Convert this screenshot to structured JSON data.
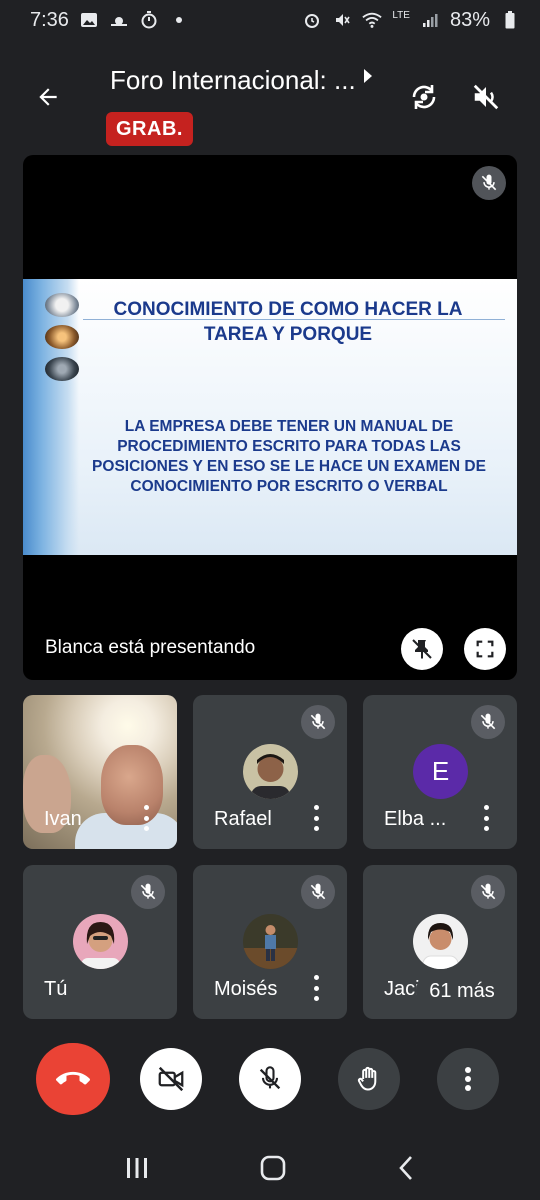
{
  "status_bar": {
    "time": "7:36",
    "network_label": "LTE",
    "battery": "83%"
  },
  "header": {
    "title": "Foro Internacional: ...",
    "recording_badge": "GRAB."
  },
  "presentation": {
    "slide_title": "CONOCIMIENTO DE COMO HACER LA TAREA Y PORQUE",
    "slide_body": "LA EMPRESA DEBE TENER UN MANUAL DE PROCEDIMIENTO ESCRITO PARA TODAS LAS POSICIONES Y EN ESO SE LE HACE UN EXAMEN DE CONOCIMIENTO POR ESCRITO O VERBAL",
    "presenter_caption": "Blanca está presentando"
  },
  "participants": [
    {
      "name": "Ivan"
    },
    {
      "name": "Rafael"
    },
    {
      "name": "Elba ...",
      "initial": "E"
    },
    {
      "name": "Tú"
    },
    {
      "name": "Moisés"
    },
    {
      "name": "Jacinta"
    }
  ],
  "more_participants": "61 más",
  "colors": {
    "background": "#202124",
    "tile": "#3c4043",
    "end_call": "#ea4335",
    "recording": "#c5221f",
    "avatar_e": "#5b2aa8",
    "slide_text": "#1b3a8c"
  }
}
